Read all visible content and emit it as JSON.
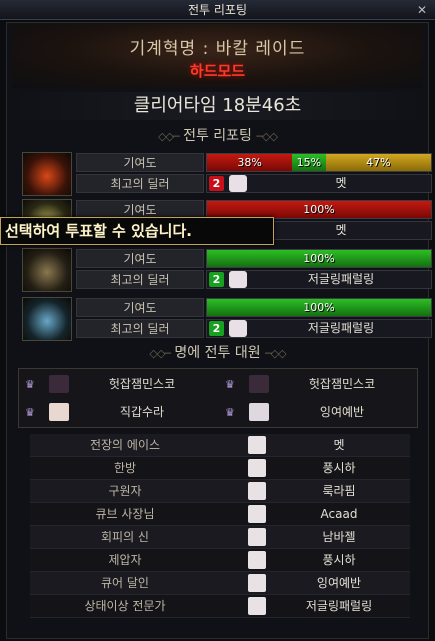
{
  "window": {
    "title": "전투 리포팅",
    "close_label": "✕"
  },
  "header": {
    "raid_title": "기계혁명 : 바칼 레이드",
    "mode": "하드모드"
  },
  "clear_time": "클리어타임 18분46초",
  "section_report": "전투 리포팅",
  "section_party": "명에 전투 대원",
  "tooltip": "선택하여 투표할 수 있습니다.",
  "labels": {
    "contribution": "기여도",
    "best_dealer": "최고의 딜러"
  },
  "reports": [
    {
      "segments": [
        {
          "label": "38%",
          "value": 38,
          "color": "red"
        },
        {
          "label": "15%",
          "value": 15,
          "color": "green"
        },
        {
          "label": "47%",
          "value": 47,
          "color": "gold"
        }
      ],
      "dealer_rank": "2",
      "dealer_medal": "red",
      "dealer": "멧"
    },
    {
      "segments": [
        {
          "label": "100%",
          "value": 100,
          "color": "red"
        }
      ],
      "dealer_rank": "",
      "dealer_medal": "",
      "dealer": "멧"
    },
    {
      "segments": [
        {
          "label": "100%",
          "value": 100,
          "color": "green"
        }
      ],
      "dealer_rank": "2",
      "dealer_medal": "green",
      "dealer": "저글링패럴링"
    },
    {
      "segments": [
        {
          "label": "100%",
          "value": 100,
          "color": "green"
        }
      ],
      "dealer_rank": "2",
      "dealer_medal": "green",
      "dealer": "저글링패럴링"
    }
  ],
  "party": [
    {
      "name": "헛잡잼민스코"
    },
    {
      "name": "헛잡잼민스코"
    },
    {
      "name": "직갑수라"
    },
    {
      "name": "잉여예반"
    }
  ],
  "awards": [
    {
      "title": "전장의 에이스",
      "name": "멧"
    },
    {
      "title": "한방",
      "name": "풍시하"
    },
    {
      "title": "구원자",
      "name": "룩라핌"
    },
    {
      "title": "큐브 사장님",
      "name": "Acaad"
    },
    {
      "title": "회피의 신",
      "name": "남바젤"
    },
    {
      "title": "제압자",
      "name": "풍시하"
    },
    {
      "title": "큐어 달인",
      "name": "잉여예반"
    },
    {
      "title": "상태이상 전문가",
      "name": "저글링패럴링"
    }
  ],
  "colors": {
    "accent_red": "#ff3a2a",
    "bar_red": "#c41a10",
    "bar_green": "#2cbf24",
    "bar_gold": "#d2a820",
    "tooltip_border": "#bfa35a"
  }
}
